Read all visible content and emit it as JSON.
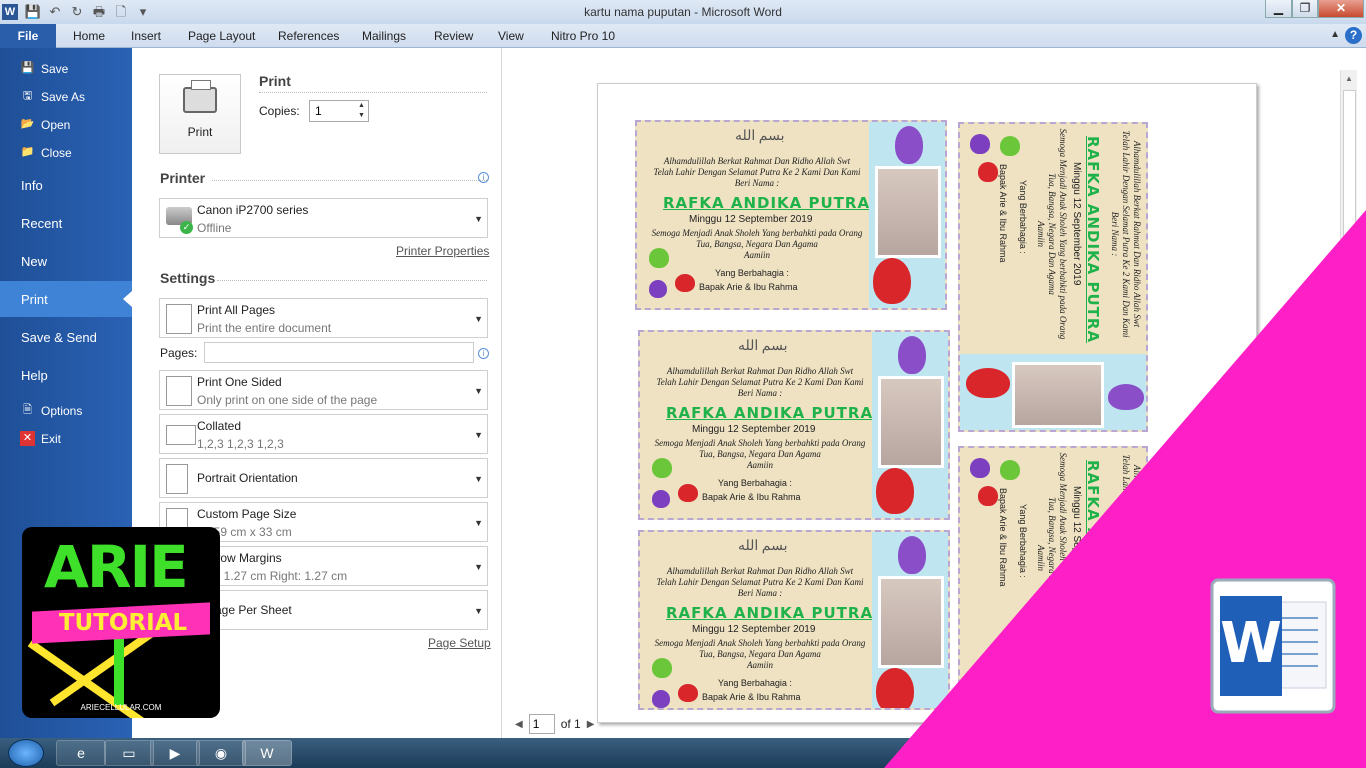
{
  "window": {
    "title": "kartu nama puputan - Microsoft Word",
    "app_letter": "W"
  },
  "qat": [
    "💾",
    "↶",
    "↻",
    "🖶",
    "🗋",
    "▾"
  ],
  "window_buttons": {
    "min": "▁",
    "max": "❐",
    "close": "✕"
  },
  "ribbon": {
    "file": "File",
    "tabs": [
      "Home",
      "Insert",
      "Page Layout",
      "References",
      "Mailings",
      "Review",
      "View",
      "Nitro Pro 10"
    ],
    "help": "?"
  },
  "backstage": {
    "save": "Save",
    "save_as": "Save As",
    "open": "Open",
    "close": "Close",
    "info": "Info",
    "recent": "Recent",
    "new": "New",
    "print": "Print",
    "save_send": "Save & Send",
    "help": "Help",
    "options": "Options",
    "exit": "Exit"
  },
  "print_panel": {
    "print_button": "Print",
    "heading": "Print",
    "copies_label": "Copies:",
    "copies_value": "1",
    "printer_heading": "Printer",
    "printer_name": "Canon iP2700 series",
    "printer_status": "Offline",
    "printer_properties": "Printer Properties",
    "settings_heading": "Settings",
    "print_all": "Print All Pages",
    "print_all_sub": "Print the entire document",
    "pages_label": "Pages:",
    "pages_value": "",
    "one_sided": "Print One Sided",
    "one_sided_sub": "Only print on one side of the page",
    "collated": "Collated",
    "collated_sub": "1,2,3    1,2,3    1,2,3",
    "orientation": "Portrait Orientation",
    "page_size": "Custom Page Size",
    "page_size_sub": "21,59 cm x 33 cm",
    "margins": "Narrow Margins",
    "margins_sub": "Left:  1.27 cm    Right:  1.27 cm",
    "per_sheet": "1 Page Per Sheet",
    "page_setup": "Page Setup"
  },
  "card": {
    "calligraphy": "بسم الله",
    "line1": "Alhamdulillah Berkat Rahmat Dan Ridho Allah Swt",
    "line2": "Telah Lahir Dengan Selamat Putra Ke 2 Kami Dan Kami",
    "line3": "Beri Nama :",
    "name": "RAFKA ANDIKA PUTRA",
    "date": "Minggu 12 September 2019",
    "line4": "Semoga Menjadi Anak Sholeh Yang berbahkti pada Orang",
    "line5": "Tua, Bangsa, Negara Dan Agama",
    "line6": "Aamiin",
    "line7": "Yang Berbahagia :",
    "parents": "Bapak Arie & Ibu Rahma"
  },
  "nav": {
    "page": "1",
    "of": "of 1"
  },
  "logo": {
    "arie": "ARIE",
    "tutorial": "TUTORIAL",
    "site": "ARIECELLULAR.COM",
    "word": "W"
  },
  "colors": {
    "accent": "#2a5daa",
    "overlay": "#ff1fc6",
    "name_green": "#1fb24a"
  }
}
